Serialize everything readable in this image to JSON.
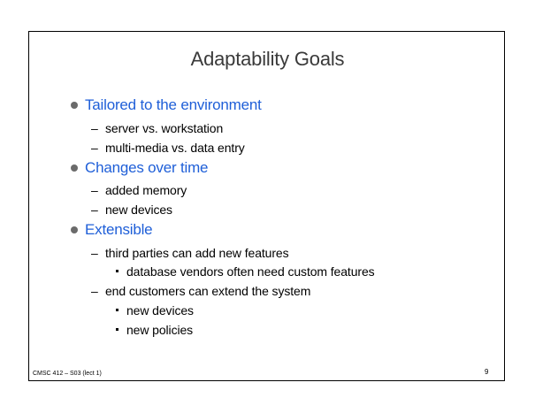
{
  "slide": {
    "title": "Adaptability Goals",
    "items": [
      {
        "text": "Tailored to the environment",
        "subitems": [
          {
            "text": "server vs. workstation"
          },
          {
            "text": "multi-media vs. data entry"
          }
        ]
      },
      {
        "text": "Changes over time",
        "subitems": [
          {
            "text": "added memory"
          },
          {
            "text": "new devices"
          }
        ]
      },
      {
        "text": "Extensible",
        "subitems": [
          {
            "text": "third parties can add new features",
            "subitems": [
              {
                "text": "database vendors often need custom features"
              }
            ]
          },
          {
            "text": "end customers can extend the system",
            "subitems": [
              {
                "text": "new devices"
              },
              {
                "text": "new policies"
              }
            ]
          }
        ]
      }
    ],
    "dash_glyph": "–",
    "footer": "CMSC 412 – S03 (lect 1)",
    "page_number": "9"
  },
  "colors": {
    "title": "#3a3a3a",
    "level1": "#1f5fd8",
    "bullet": "#6b6b6b",
    "body": "#000000",
    "frame": "#000000"
  }
}
